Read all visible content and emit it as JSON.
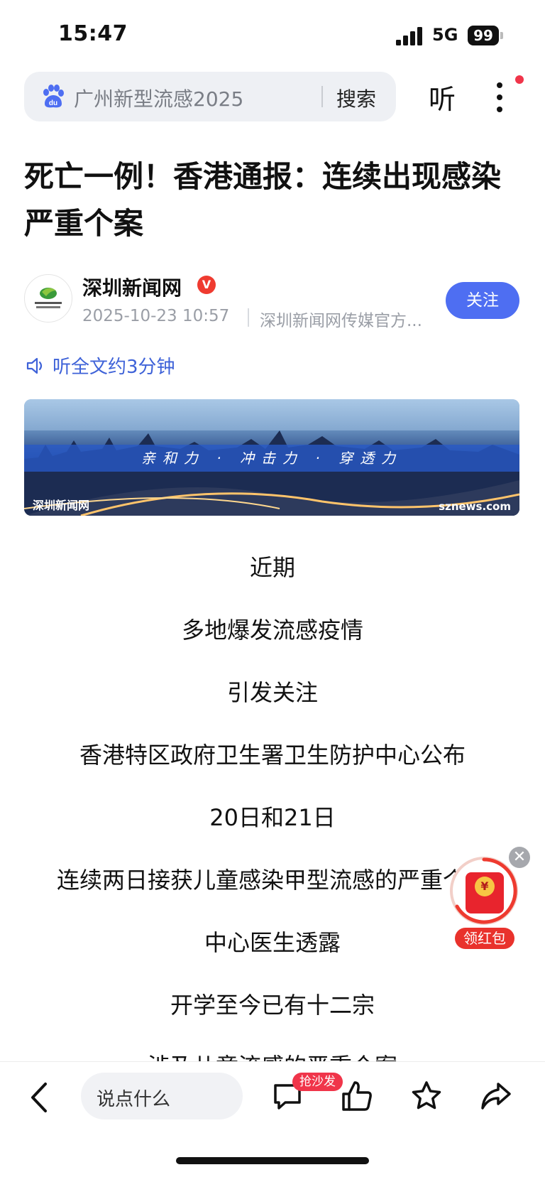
{
  "status_bar": {
    "time": "15:47",
    "network": "5G",
    "battery": "99"
  },
  "search": {
    "query": "广州新型流感2025",
    "button": "搜索"
  },
  "top_actions": {
    "listen": "听"
  },
  "article": {
    "title": "死亡一例！香港通报：连续出现感染严重个案",
    "author": "深圳新闻网",
    "verified_badge": "V",
    "date": "2025-10-23 10:57",
    "source": "深圳新闻网传媒官方...",
    "follow": "关注",
    "listen_full": "听全文约3分钟",
    "banner": {
      "slogan": "亲和力 · 冲击力 · 穿透力",
      "logo_left": "深圳新闻网",
      "logo_right": "sznews.com"
    },
    "body_lines": [
      "近期",
      "多地爆发流感疫情",
      "引发关注",
      "香港特区政府卫生署卫生防护中心公布",
      "20日和21日",
      "连续两日接获儿童感染甲型流感的严重个案",
      "中心医生透露",
      "开学至今已有十二宗",
      "涉及儿童流感的严重个案"
    ]
  },
  "red_packet": {
    "label": "领红包",
    "coin": "¥",
    "close": "✕"
  },
  "bottom_bar": {
    "comment_placeholder": "说点什么",
    "sofa_badge": "抢沙发",
    "icons": [
      "back-icon",
      "comment-icon",
      "like-icon",
      "star-icon",
      "share-icon"
    ]
  },
  "colors": {
    "accent": "#4e6ef2",
    "link": "#3e62d8",
    "badge_red": "#f0354a"
  }
}
